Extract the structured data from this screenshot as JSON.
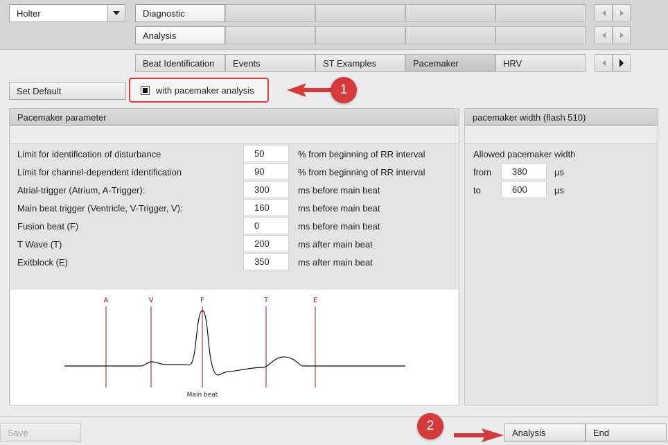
{
  "header": {
    "mode_select": {
      "value": "Holter"
    },
    "row1_tab": "Diagnostic",
    "row2_tab": "Analysis",
    "subtabs": [
      "Beat Identification",
      "Events",
      "ST Examples",
      "Pacemaker",
      "HRV"
    ],
    "active_subtab": "Pacemaker"
  },
  "toolbar": {
    "set_default": "Set Default",
    "pacemaker_checkbox_label": "with pacemaker analysis",
    "pacemaker_checked": true
  },
  "params_panel": {
    "title": "Pacemaker parameter",
    "rows": [
      {
        "label": "Limit for identification of disturbance",
        "value": "50",
        "unit": "% from beginning of RR interval"
      },
      {
        "label": "Limit for channel-dependent identification",
        "value": "90",
        "unit": "% from beginning of RR interval"
      },
      {
        "label": "Atrial-trigger (Atrium, A-Trigger):",
        "value": "300",
        "unit": "ms before main beat"
      },
      {
        "label": "Main beat trigger (Ventricle, V-Trigger, V):",
        "value": "160",
        "unit": "ms before main beat"
      },
      {
        "label": "Fusion beat (F)",
        "value": "0",
        "unit": "ms before main beat"
      },
      {
        "label": "T Wave (T)",
        "value": "200",
        "unit": "ms after main beat"
      },
      {
        "label": "Exitblock (E)",
        "value": "350",
        "unit": "ms after main beat"
      }
    ],
    "diagram": {
      "markers": [
        "A",
        "V",
        "F",
        "T",
        "E"
      ],
      "caption": "Main beat",
      "marker_color": "#a01818"
    }
  },
  "width_panel": {
    "title": "pacemaker width (flash 510)",
    "section_label": "Allowed pacemaker width",
    "from_label": "from",
    "from_value": "380",
    "to_label": "to",
    "to_value": "600",
    "unit": "µs"
  },
  "footer": {
    "save": "Save",
    "analysis": "Analysis",
    "end": "End"
  },
  "annotations": {
    "marker1": "1",
    "marker2": "2",
    "color": "#d5393b"
  }
}
